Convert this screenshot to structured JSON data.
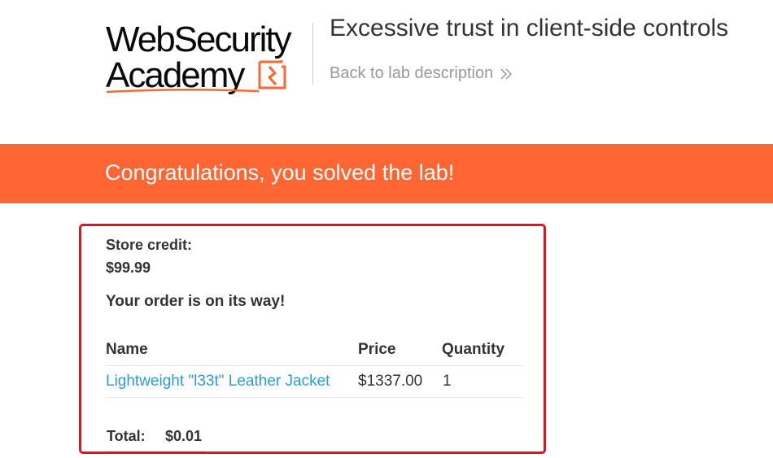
{
  "logo": {
    "line1": "WebSecurity",
    "line2": "Academy",
    "brand_color": "#ff6633"
  },
  "header": {
    "title": "Excessive trust in client-side controls",
    "back_link": "Back to lab description",
    "back_icon": "chevron-double-right-icon"
  },
  "banner": {
    "text": "Congratulations, you solved the lab!",
    "color": "#ff6633"
  },
  "account": {
    "store_credit_label": "Store credit:",
    "store_credit_value": "$99.99"
  },
  "order": {
    "message": "Your order is on its way!",
    "columns": [
      "Name",
      "Price",
      "Quantity"
    ],
    "items": [
      {
        "name": "Lightweight \"l33t\" Leather Jacket",
        "price": "$1337.00",
        "quantity": "1"
      }
    ],
    "total_label": "Total:",
    "total_value": "$0.01",
    "highlight_color": "#e0141d"
  }
}
